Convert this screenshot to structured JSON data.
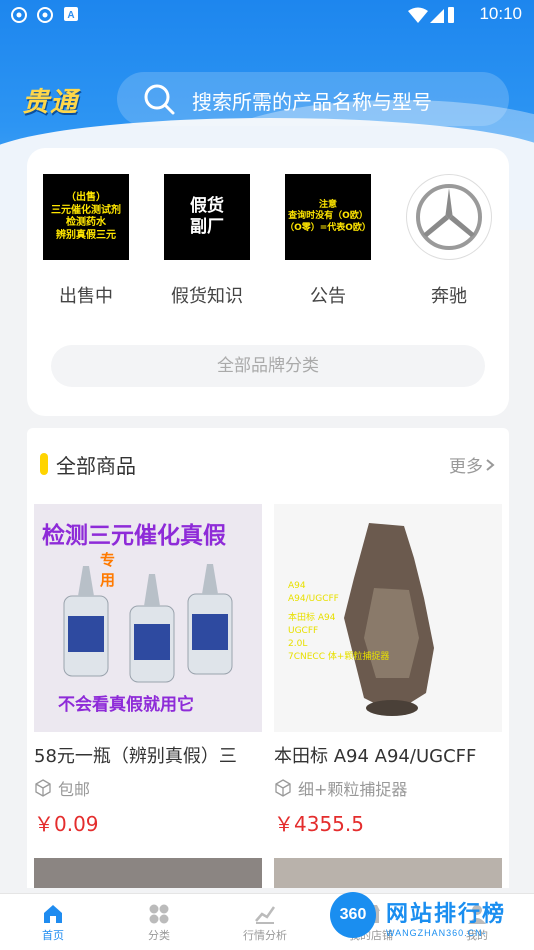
{
  "status_bar": {
    "time": "10:10"
  },
  "header": {
    "logo": "贵通",
    "search_placeholder": "搜索所需的产品名称与型号"
  },
  "categories": [
    {
      "label": "出售中",
      "image_lines": [
        "（出售）",
        "三元催化测试剂",
        "检测药水",
        "辨别真假三元"
      ]
    },
    {
      "label": "假货知识",
      "image_lines": [
        "假货",
        "副厂"
      ]
    },
    {
      "label": "公告",
      "image_lines": [
        "注意",
        "查询时没有（O欧）",
        "（O零）=代表O欧）"
      ]
    },
    {
      "label": "奔驰",
      "image_lines": []
    }
  ],
  "brand_button": "全部品牌分类",
  "products_section": {
    "title": "全部商品",
    "more": "更多"
  },
  "products": [
    {
      "name": "58元一瓶（辨别真假）三",
      "shipping": "包邮",
      "price": "￥0.09",
      "image_text": {
        "headline": "检测三元催化真假",
        "side": "专用",
        "footer": "不会看真假就用它"
      }
    },
    {
      "name": "本田标 A94 A94/UGCFF",
      "shipping": "细+颗粒捕捉器",
      "price": "￥4355.5",
      "image_text": {
        "lines": [
          "A94",
          "A94/UGCFF",
          "本田标 A94",
          "UGCFF",
          "2.0L",
          "7CNECC 体+颗粒捕捉器"
        ]
      }
    }
  ],
  "tabbar": [
    {
      "label": "首页",
      "icon": "home-icon",
      "active": true
    },
    {
      "label": "分类",
      "icon": "grid-icon",
      "active": false
    },
    {
      "label": "行情分析",
      "icon": "chart-icon",
      "active": false
    },
    {
      "label": "我的店铺",
      "icon": "store-icon",
      "active": false
    },
    {
      "label": "我的",
      "icon": "user-icon",
      "active": false
    }
  ],
  "watermark": {
    "badge": "360",
    "text": "网站排行榜",
    "sub": "WANGZHAN360.CN-"
  },
  "colors": {
    "primary": "#1f8cf0",
    "price": "#e42d2d",
    "accent": "#ffd400"
  }
}
